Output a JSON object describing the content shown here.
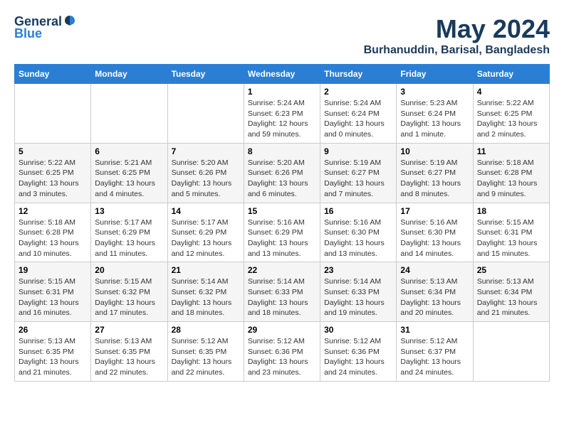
{
  "logo": {
    "general": "General",
    "blue": "Blue"
  },
  "title": "May 2024",
  "subtitle": "Burhanuddin, Barisal, Bangladesh",
  "headers": [
    "Sunday",
    "Monday",
    "Tuesday",
    "Wednesday",
    "Thursday",
    "Friday",
    "Saturday"
  ],
  "weeks": [
    [
      {
        "day": "",
        "info": ""
      },
      {
        "day": "",
        "info": ""
      },
      {
        "day": "",
        "info": ""
      },
      {
        "day": "1",
        "info": "Sunrise: 5:24 AM\nSunset: 6:23 PM\nDaylight: 12 hours and 59 minutes."
      },
      {
        "day": "2",
        "info": "Sunrise: 5:24 AM\nSunset: 6:24 PM\nDaylight: 13 hours and 0 minutes."
      },
      {
        "day": "3",
        "info": "Sunrise: 5:23 AM\nSunset: 6:24 PM\nDaylight: 13 hours and 1 minute."
      },
      {
        "day": "4",
        "info": "Sunrise: 5:22 AM\nSunset: 6:25 PM\nDaylight: 13 hours and 2 minutes."
      }
    ],
    [
      {
        "day": "5",
        "info": "Sunrise: 5:22 AM\nSunset: 6:25 PM\nDaylight: 13 hours and 3 minutes."
      },
      {
        "day": "6",
        "info": "Sunrise: 5:21 AM\nSunset: 6:25 PM\nDaylight: 13 hours and 4 minutes."
      },
      {
        "day": "7",
        "info": "Sunrise: 5:20 AM\nSunset: 6:26 PM\nDaylight: 13 hours and 5 minutes."
      },
      {
        "day": "8",
        "info": "Sunrise: 5:20 AM\nSunset: 6:26 PM\nDaylight: 13 hours and 6 minutes."
      },
      {
        "day": "9",
        "info": "Sunrise: 5:19 AM\nSunset: 6:27 PM\nDaylight: 13 hours and 7 minutes."
      },
      {
        "day": "10",
        "info": "Sunrise: 5:19 AM\nSunset: 6:27 PM\nDaylight: 13 hours and 8 minutes."
      },
      {
        "day": "11",
        "info": "Sunrise: 5:18 AM\nSunset: 6:28 PM\nDaylight: 13 hours and 9 minutes."
      }
    ],
    [
      {
        "day": "12",
        "info": "Sunrise: 5:18 AM\nSunset: 6:28 PM\nDaylight: 13 hours and 10 minutes."
      },
      {
        "day": "13",
        "info": "Sunrise: 5:17 AM\nSunset: 6:29 PM\nDaylight: 13 hours and 11 minutes."
      },
      {
        "day": "14",
        "info": "Sunrise: 5:17 AM\nSunset: 6:29 PM\nDaylight: 13 hours and 12 minutes."
      },
      {
        "day": "15",
        "info": "Sunrise: 5:16 AM\nSunset: 6:29 PM\nDaylight: 13 hours and 13 minutes."
      },
      {
        "day": "16",
        "info": "Sunrise: 5:16 AM\nSunset: 6:30 PM\nDaylight: 13 hours and 13 minutes."
      },
      {
        "day": "17",
        "info": "Sunrise: 5:16 AM\nSunset: 6:30 PM\nDaylight: 13 hours and 14 minutes."
      },
      {
        "day": "18",
        "info": "Sunrise: 5:15 AM\nSunset: 6:31 PM\nDaylight: 13 hours and 15 minutes."
      }
    ],
    [
      {
        "day": "19",
        "info": "Sunrise: 5:15 AM\nSunset: 6:31 PM\nDaylight: 13 hours and 16 minutes."
      },
      {
        "day": "20",
        "info": "Sunrise: 5:15 AM\nSunset: 6:32 PM\nDaylight: 13 hours and 17 minutes."
      },
      {
        "day": "21",
        "info": "Sunrise: 5:14 AM\nSunset: 6:32 PM\nDaylight: 13 hours and 18 minutes."
      },
      {
        "day": "22",
        "info": "Sunrise: 5:14 AM\nSunset: 6:33 PM\nDaylight: 13 hours and 18 minutes."
      },
      {
        "day": "23",
        "info": "Sunrise: 5:14 AM\nSunset: 6:33 PM\nDaylight: 13 hours and 19 minutes."
      },
      {
        "day": "24",
        "info": "Sunrise: 5:13 AM\nSunset: 6:34 PM\nDaylight: 13 hours and 20 minutes."
      },
      {
        "day": "25",
        "info": "Sunrise: 5:13 AM\nSunset: 6:34 PM\nDaylight: 13 hours and 21 minutes."
      }
    ],
    [
      {
        "day": "26",
        "info": "Sunrise: 5:13 AM\nSunset: 6:35 PM\nDaylight: 13 hours and 21 minutes."
      },
      {
        "day": "27",
        "info": "Sunrise: 5:13 AM\nSunset: 6:35 PM\nDaylight: 13 hours and 22 minutes."
      },
      {
        "day": "28",
        "info": "Sunrise: 5:12 AM\nSunset: 6:35 PM\nDaylight: 13 hours and 22 minutes."
      },
      {
        "day": "29",
        "info": "Sunrise: 5:12 AM\nSunset: 6:36 PM\nDaylight: 13 hours and 23 minutes."
      },
      {
        "day": "30",
        "info": "Sunrise: 5:12 AM\nSunset: 6:36 PM\nDaylight: 13 hours and 24 minutes."
      },
      {
        "day": "31",
        "info": "Sunrise: 5:12 AM\nSunset: 6:37 PM\nDaylight: 13 hours and 24 minutes."
      },
      {
        "day": "",
        "info": ""
      }
    ]
  ]
}
